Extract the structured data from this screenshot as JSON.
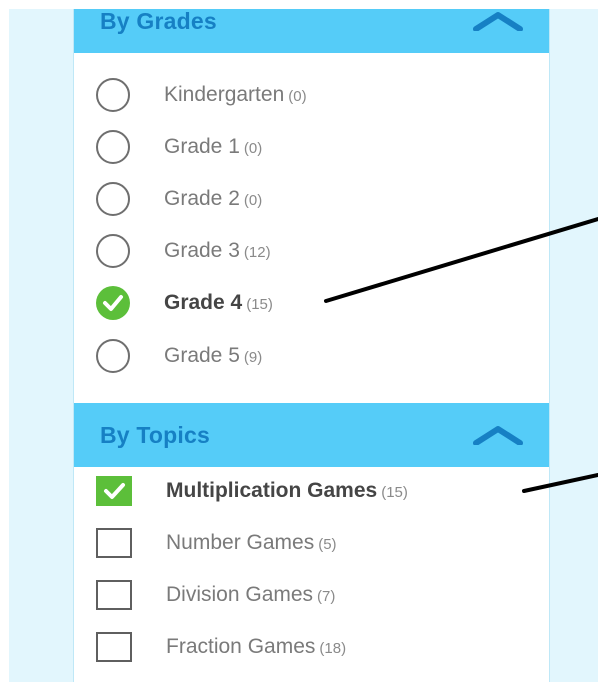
{
  "grades": {
    "title": "By Grades",
    "items": [
      {
        "label": "Kindergarten",
        "count": "(0)",
        "checked": false
      },
      {
        "label": "Grade 1",
        "count": "(0)",
        "checked": false
      },
      {
        "label": "Grade 2",
        "count": "(0)",
        "checked": false
      },
      {
        "label": "Grade 3",
        "count": "(12)",
        "checked": false
      },
      {
        "label": "Grade 4",
        "count": "(15)",
        "checked": true
      },
      {
        "label": "Grade 5",
        "count": "(9)",
        "checked": false
      }
    ]
  },
  "topics": {
    "title": "By Topics",
    "items": [
      {
        "label": "Multiplication Games",
        "count": "(15)",
        "checked": true
      },
      {
        "label": "Number Games",
        "count": "(5)",
        "checked": false
      },
      {
        "label": "Division Games",
        "count": "(7)",
        "checked": false
      },
      {
        "label": "Fraction Games",
        "count": "(18)",
        "checked": false
      }
    ]
  },
  "colors": {
    "header_bg": "#55ccf8",
    "header_text": "#1680c4",
    "check_green": "#5cbf3a",
    "page_bg": "#e2f6fd"
  }
}
